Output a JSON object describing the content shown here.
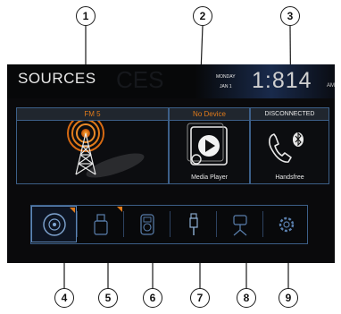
{
  "screen": {
    "title": "SOURCES",
    "title_ghost": "CES",
    "day": "MONDAY",
    "date": "JAN 1",
    "time": "1:814",
    "ampm": "AM"
  },
  "panels": [
    {
      "header": "FM 5",
      "header_color": "#e07a1a",
      "caption": "",
      "icon": "radio-tower-icon"
    },
    {
      "header": "No Device",
      "header_color": "#e07a1a",
      "caption": "Media Player",
      "icon": "media-player-icon"
    },
    {
      "header": "DISCONNECTED",
      "header_color": "#e8e8e8",
      "caption": "Handsfree",
      "icon": "phone-bluetooth-icon"
    }
  ],
  "sources_bar": [
    {
      "icon": "disc-icon",
      "flag": true
    },
    {
      "icon": "usb-icon",
      "flag": true
    },
    {
      "icon": "ipod-icon",
      "flag": false
    },
    {
      "icon": "aux-icon",
      "flag": false
    },
    {
      "icon": "camera-icon",
      "flag": false
    },
    {
      "icon": "settings-icon",
      "flag": false
    }
  ],
  "callouts": [
    "1",
    "2",
    "3",
    "4",
    "5",
    "6",
    "7",
    "8",
    "9"
  ],
  "colors": {
    "accent_orange": "#e07a1a",
    "frame_blue": "#3c5f88",
    "screen_bg": "#0a0a0c"
  }
}
